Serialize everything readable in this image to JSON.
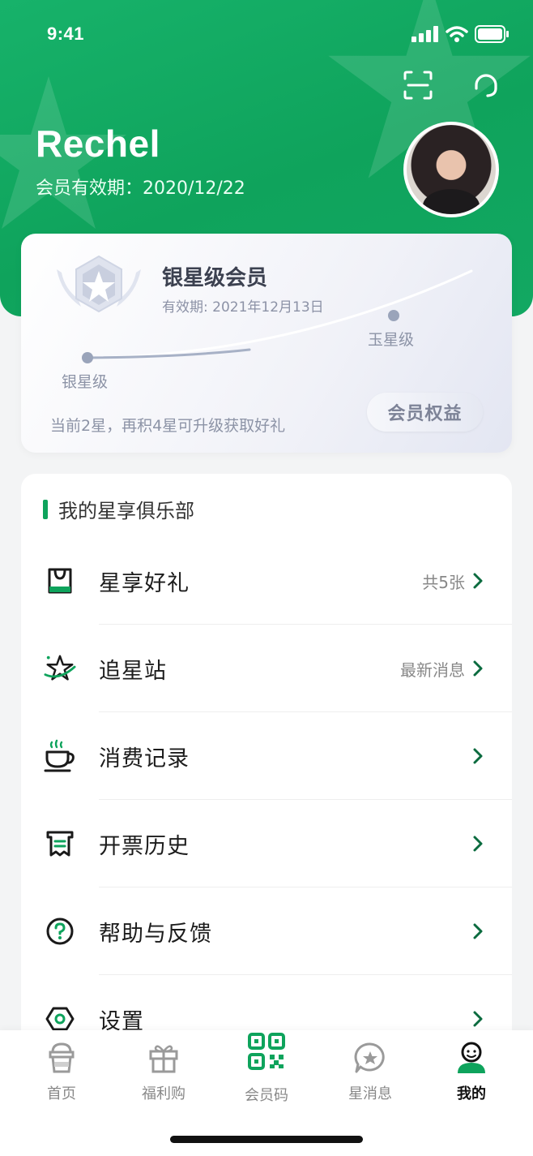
{
  "status": {
    "time": "9:41"
  },
  "header": {
    "user_name": "Rechel",
    "validity": "会员有效期：2020/12/22",
    "icons": [
      "scan-icon",
      "headset-icon"
    ]
  },
  "member_card": {
    "tier": "银星级会员",
    "expiry": "有效期: 2021年12月13日",
    "current_level": "银星级",
    "next_level": "玉星级",
    "progress_hint": "当前2星，再积4星可升级获取好礼",
    "benefits_button": "会员权益",
    "progress_fraction": 0.33
  },
  "club": {
    "title": "我的星享俱乐部",
    "items": [
      {
        "icon": "gift-bag-icon",
        "label": "星享好礼",
        "extra": "共5张"
      },
      {
        "icon": "star-orbit-icon",
        "label": "追星站",
        "extra": "最新消息"
      },
      {
        "icon": "coffee-cup-icon",
        "label": "消费记录",
        "extra": ""
      },
      {
        "icon": "receipt-icon",
        "label": "开票历史",
        "extra": ""
      },
      {
        "icon": "help-icon",
        "label": "帮助与反馈",
        "extra": ""
      },
      {
        "icon": "settings-icon",
        "label": "设置",
        "extra": ""
      }
    ]
  },
  "tabbar": {
    "tabs": [
      {
        "icon": "home-cup-icon",
        "label": "首页"
      },
      {
        "icon": "gift-icon",
        "label": "福利购"
      },
      {
        "icon": "qr-code-icon",
        "label": "会员码"
      },
      {
        "icon": "message-star-icon",
        "label": "星消息"
      },
      {
        "icon": "profile-icon",
        "label": "我的"
      }
    ],
    "active_index": 4
  },
  "colors": {
    "brand_green": "#0ea35c",
    "card_text": "#3c4150",
    "muted": "#8c93a6"
  }
}
